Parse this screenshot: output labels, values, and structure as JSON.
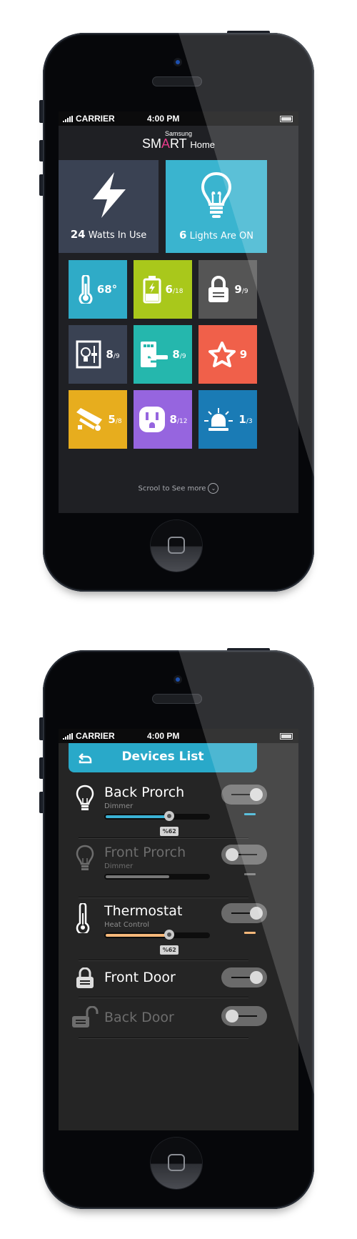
{
  "status_bar": {
    "carrier": "CARRIER",
    "time": "4:00 PM"
  },
  "home_screen": {
    "brand": {
      "company": "Samsung",
      "product_prefix": "SM",
      "product_accent": "A",
      "product_suffix": "RT",
      "product_sub": "Home"
    },
    "summary_tiles": [
      {
        "id": "power",
        "icon": "lightning-icon",
        "value": "24",
        "label": "Watts In Use",
        "color": "#3a4253"
      },
      {
        "id": "lights",
        "icon": "lightbulb-icon",
        "value": "6",
        "label": "Lights Are ON",
        "color": "#3ab4cf"
      }
    ],
    "tiles": [
      {
        "id": "thermostat",
        "icon": "thermometer-icon",
        "value": "68°",
        "total": "",
        "color": "#2fabc7"
      },
      {
        "id": "battery",
        "icon": "battery-icon",
        "value": "6",
        "total": "/18",
        "color": "#a9c81b"
      },
      {
        "id": "locks",
        "icon": "padlock-icon",
        "value": "9",
        "total": "/9",
        "color": "#555555"
      },
      {
        "id": "switches",
        "icon": "dimmer-switch-icon",
        "value": "8",
        "total": "/9",
        "color": "#3a4253"
      },
      {
        "id": "door-locks",
        "icon": "keypad-lock-icon",
        "value": "8",
        "total": "/9",
        "color": "#25b7ad"
      },
      {
        "id": "favorites",
        "icon": "star-icon",
        "value": "9",
        "total": "",
        "color": "#f0604a"
      },
      {
        "id": "cameras",
        "icon": "security-camera-icon",
        "value": "5",
        "total": "/8",
        "color": "#e7ad1e"
      },
      {
        "id": "outlets",
        "icon": "power-outlet-icon",
        "value": "8",
        "total": "/12",
        "color": "#9665df"
      },
      {
        "id": "alarms",
        "icon": "siren-icon",
        "value": "1",
        "total": "/3",
        "color": "#1a7bb5"
      }
    ],
    "scroll_hint": "Scrool to See more"
  },
  "devices_screen": {
    "title": "Devices List",
    "devices": [
      {
        "name": "Back Prorch",
        "type": "Dimmer",
        "on": true,
        "level_percent": 62,
        "level_label": "%62",
        "accent": "#3ab2d5"
      },
      {
        "name": "Front Prorch",
        "type": "Dimmer",
        "on": false,
        "level_percent": 62,
        "level_label": "",
        "accent": "#777777"
      },
      {
        "name": "Thermostat",
        "type": "Heat Control",
        "on": true,
        "level_percent": 62,
        "level_label": "%62",
        "accent": "#f6b87a"
      },
      {
        "name": "Front Door",
        "type": "",
        "on": true
      },
      {
        "name": "Back Door",
        "type": "",
        "on": false
      }
    ]
  }
}
